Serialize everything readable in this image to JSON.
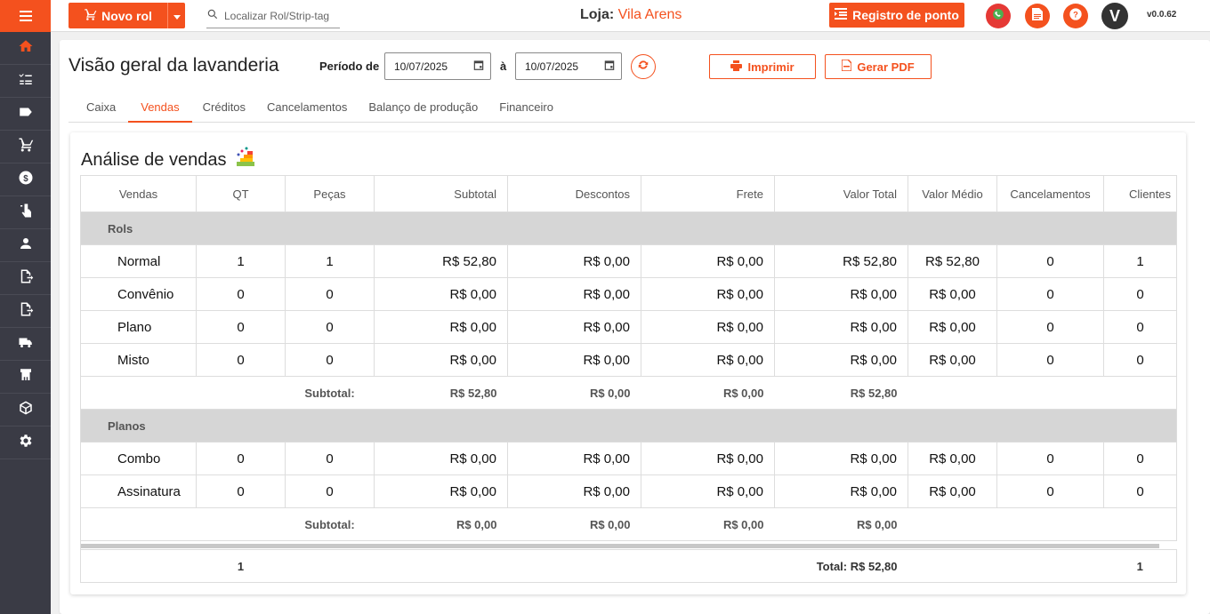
{
  "topbar": {
    "novo_rol_label": "Novo rol",
    "search_placeholder": "Localizar Rol/Strip-tag",
    "loja_label": "Loja:",
    "loja_value": "Vila Arens",
    "registro_ponto_label": "Registro de ponto",
    "avatar_letter": "V",
    "version": "v0.0.62"
  },
  "colors": {
    "accent": "#f4511e",
    "sidebar": "#3a3b45",
    "whatsapp": "#e53935"
  },
  "sidebar": {
    "items": [
      "home-icon",
      "checklist-icon",
      "tag-icon",
      "cart-icon",
      "dollar-icon",
      "touch-icon",
      "user-icon",
      "export-icon",
      "export-alt-icon",
      "truck-icon",
      "laundry-icon",
      "box-icon",
      "gear-icon"
    ]
  },
  "header": {
    "title": "Visão geral da lavanderia",
    "periodo_label": "Período de",
    "date_from": "10/07/2025",
    "a_label": "à",
    "date_to": "10/07/2025",
    "imprimir_label": "Imprimir",
    "gerar_pdf_label": "Gerar PDF"
  },
  "tabs": [
    {
      "label": "Caixa",
      "active": false
    },
    {
      "label": "Vendas",
      "active": true
    },
    {
      "label": "Créditos",
      "active": false
    },
    {
      "label": "Cancelamentos",
      "active": false
    },
    {
      "label": "Balanço de produção",
      "active": false
    },
    {
      "label": "Financeiro",
      "active": false
    }
  ],
  "analysis": {
    "title": "Análise de vendas",
    "columns": [
      "Vendas",
      "QT",
      "Peças",
      "Subtotal",
      "Descontos",
      "Frete",
      "Valor Total",
      "Valor Médio",
      "Cancelamentos",
      "Clientes"
    ],
    "groups": [
      {
        "name": "Rols",
        "rows": [
          [
            "Normal",
            "1",
            "1",
            "R$ 52,80",
            "R$ 0,00",
            "R$ 0,00",
            "R$ 52,80",
            "R$ 52,80",
            "0",
            "1"
          ],
          [
            "Convênio",
            "0",
            "0",
            "R$ 0,00",
            "R$ 0,00",
            "R$ 0,00",
            "R$ 0,00",
            "R$ 0,00",
            "0",
            "0"
          ],
          [
            "Plano",
            "0",
            "0",
            "R$ 0,00",
            "R$ 0,00",
            "R$ 0,00",
            "R$ 0,00",
            "R$ 0,00",
            "0",
            "0"
          ],
          [
            "Misto",
            "0",
            "0",
            "R$ 0,00",
            "R$ 0,00",
            "R$ 0,00",
            "R$ 0,00",
            "R$ 0,00",
            "0",
            "0"
          ]
        ],
        "subtotal_label": "Subtotal:",
        "subtotal": [
          "R$ 52,80",
          "R$ 0,00",
          "R$ 0,00",
          "R$ 52,80"
        ]
      },
      {
        "name": "Planos",
        "rows": [
          [
            "Combo",
            "0",
            "0",
            "R$ 0,00",
            "R$ 0,00",
            "R$ 0,00",
            "R$ 0,00",
            "R$ 0,00",
            "0",
            "0"
          ],
          [
            "Assinatura",
            "0",
            "0",
            "R$ 0,00",
            "R$ 0,00",
            "R$ 0,00",
            "R$ 0,00",
            "R$ 0,00",
            "0",
            "0"
          ]
        ],
        "subtotal_label": "Subtotal:",
        "subtotal": [
          "R$ 0,00",
          "R$ 0,00",
          "R$ 0,00",
          "R$ 0,00"
        ]
      }
    ],
    "total": {
      "qt": "1",
      "label": "Total: R$ 52,80",
      "clientes": "1"
    }
  }
}
